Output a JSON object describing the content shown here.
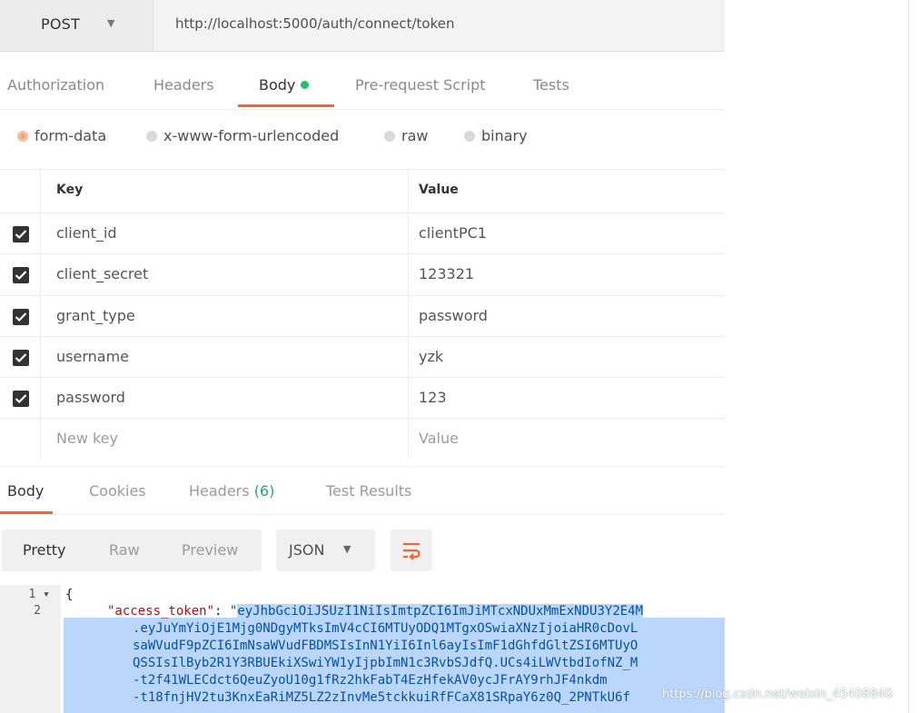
{
  "request": {
    "method": "POST",
    "url": "http://localhost:5000/auth/connect/token"
  },
  "request_tabs": [
    {
      "label": "Authorization",
      "active": false
    },
    {
      "label": "Headers",
      "active": false
    },
    {
      "label": "Body",
      "active": true
    },
    {
      "label": "Pre-request Script",
      "active": false
    },
    {
      "label": "Tests",
      "active": false
    }
  ],
  "body_types": [
    {
      "label": "form-data",
      "selected": true
    },
    {
      "label": "x-www-form-urlencoded",
      "selected": false
    },
    {
      "label": "raw",
      "selected": false
    },
    {
      "label": "binary",
      "selected": false
    }
  ],
  "params": {
    "headers": {
      "key": "Key",
      "value": "Value"
    },
    "rows": [
      {
        "checked": true,
        "key": "client_id",
        "value": "clientPC1"
      },
      {
        "checked": true,
        "key": "client_secret",
        "value": "123321"
      },
      {
        "checked": true,
        "key": "grant_type",
        "value": "password"
      },
      {
        "checked": true,
        "key": "username",
        "value": "yzk"
      },
      {
        "checked": true,
        "key": "password",
        "value": "123"
      }
    ],
    "new_key_placeholder": "New key",
    "new_value_placeholder": "Value"
  },
  "response_tabs": {
    "body": "Body",
    "cookies": "Cookies",
    "headers": "Headers",
    "headers_count": "(6)",
    "test_results": "Test Results"
  },
  "view_modes": [
    "Pretty",
    "Raw",
    "Preview"
  ],
  "active_view_mode": "Pretty",
  "format": "JSON",
  "code": {
    "line_numbers": [
      "1",
      "2"
    ],
    "fold_marker": "▾",
    "open_brace": "{",
    "key": "\"access_token\"",
    "colon": ": ",
    "quote": "\"",
    "lines": [
      "eyJhbGciOiJSUzI1NiIsImtpZCI6ImJiMTcxNDUxMmExNDU3Y2E4M",
      ".eyJuYmYiOjE1Mjg0NDgyMTksImV4cCI6MTUyODQ1MTgxOSwiaXNzIjoiaHR0cDovL",
      "saWVudF9pZCI6ImNsaWVudFBDMSIsInN1YiI6Inl6ayIsImF1dGhfdGltZSI6MTUyO",
      "QSSIsIlByb2R1Y3RBUEkiXSwiYW1yIjpbImN1c3RvbSJdfQ.UCs4iLWVtbdIofNZ_M",
      "-t2f41WLECdct6QeuZyoU10g1fRz2hkFabT4EzHfekAV0ycJFrAY9rhJF4nkdm",
      "-t18fnjHV2tu3KnxEaRiMZ5LZ2zInvMe5tckkuiRfFCaX81SRpaY6z0Q_2PNTkU6f"
    ]
  },
  "watermark": "https://blog.csdn.net/weixin_45408840"
}
